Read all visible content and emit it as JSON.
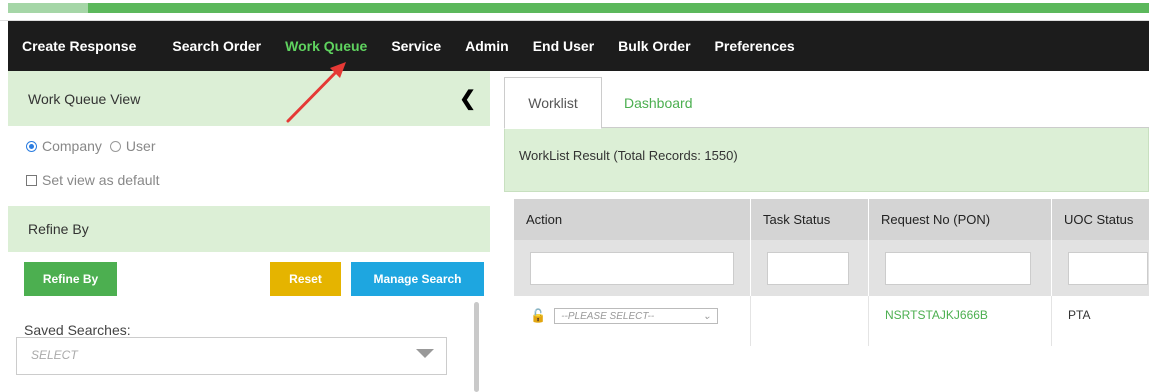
{
  "nav": {
    "items": [
      "Create Response",
      "Search Order",
      "Work Queue",
      "Service",
      "Admin",
      "End User",
      "Bulk Order",
      "Preferences"
    ],
    "active": "Work Queue"
  },
  "left_panel": {
    "title": "Work Queue View",
    "collapse_icon": "chevron-left-icon",
    "view_options": [
      "Company",
      "User"
    ],
    "selected_view": "Company",
    "default_checkbox_label": "Set view as default",
    "refine_header": "Refine By",
    "buttons": {
      "refine": "Refine By",
      "reset": "Reset",
      "manage": "Manage Search"
    },
    "saved_searches_label": "Saved Searches:",
    "saved_searches_value": "SELECT"
  },
  "right_panel": {
    "tabs": [
      "Worklist",
      "Dashboard"
    ],
    "active_tab": "Worklist",
    "result_title": "WorkList Result (Total Records: 1550)",
    "columns": [
      "Action",
      "Task Status",
      "Request No (PON)",
      "UOC Status"
    ],
    "rows": [
      {
        "action_select": "--PLEASE SELECT--",
        "task_status": "",
        "request_no": "NSRTSTAJKJ666B",
        "uoc_status": "PTA"
      }
    ]
  },
  "colors": {
    "nav_bg": "#1c1c1c",
    "active_nav": "#5fd35f",
    "panel_header_bg": "#dcefd6",
    "refine_button": "#4caf50",
    "reset_button": "#e5b400",
    "manage_button": "#1ea6e0",
    "link_green": "#4caf50",
    "annotation_arrow": "#e53935"
  }
}
